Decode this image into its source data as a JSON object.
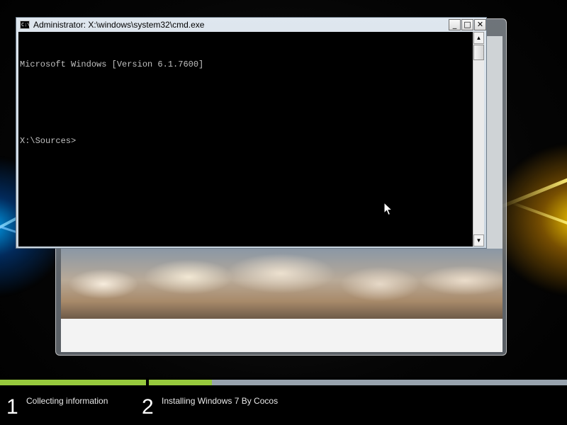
{
  "cmd_window": {
    "title": "Administrator: X:\\windows\\system32\\cmd.exe",
    "icon": "cmd-icon",
    "icon_glyph": "C:\\",
    "buttons": {
      "minimize_glyph": "_",
      "maximize_glyph": "□",
      "close_glyph": "✕"
    },
    "console_lines": [
      "Microsoft Windows [Version 6.1.7600]",
      "",
      "X:\\Sources>"
    ],
    "scrollbar": {
      "up_glyph": "▲",
      "down_glyph": "▼"
    }
  },
  "setup": {
    "progress": [
      {
        "step": 1,
        "fill_fraction": 1.0
      },
      {
        "step": 2,
        "fill_fraction": 0.15
      }
    ],
    "steps": [
      {
        "number": "1",
        "label": "Collecting information"
      },
      {
        "number": "2",
        "label": "Installing Windows 7 By Cocos"
      }
    ],
    "colors": {
      "progress_fill": "#97c93d",
      "progress_track": "#98a3ae"
    }
  },
  "cursor": {
    "icon": "arrow-cursor-icon"
  }
}
